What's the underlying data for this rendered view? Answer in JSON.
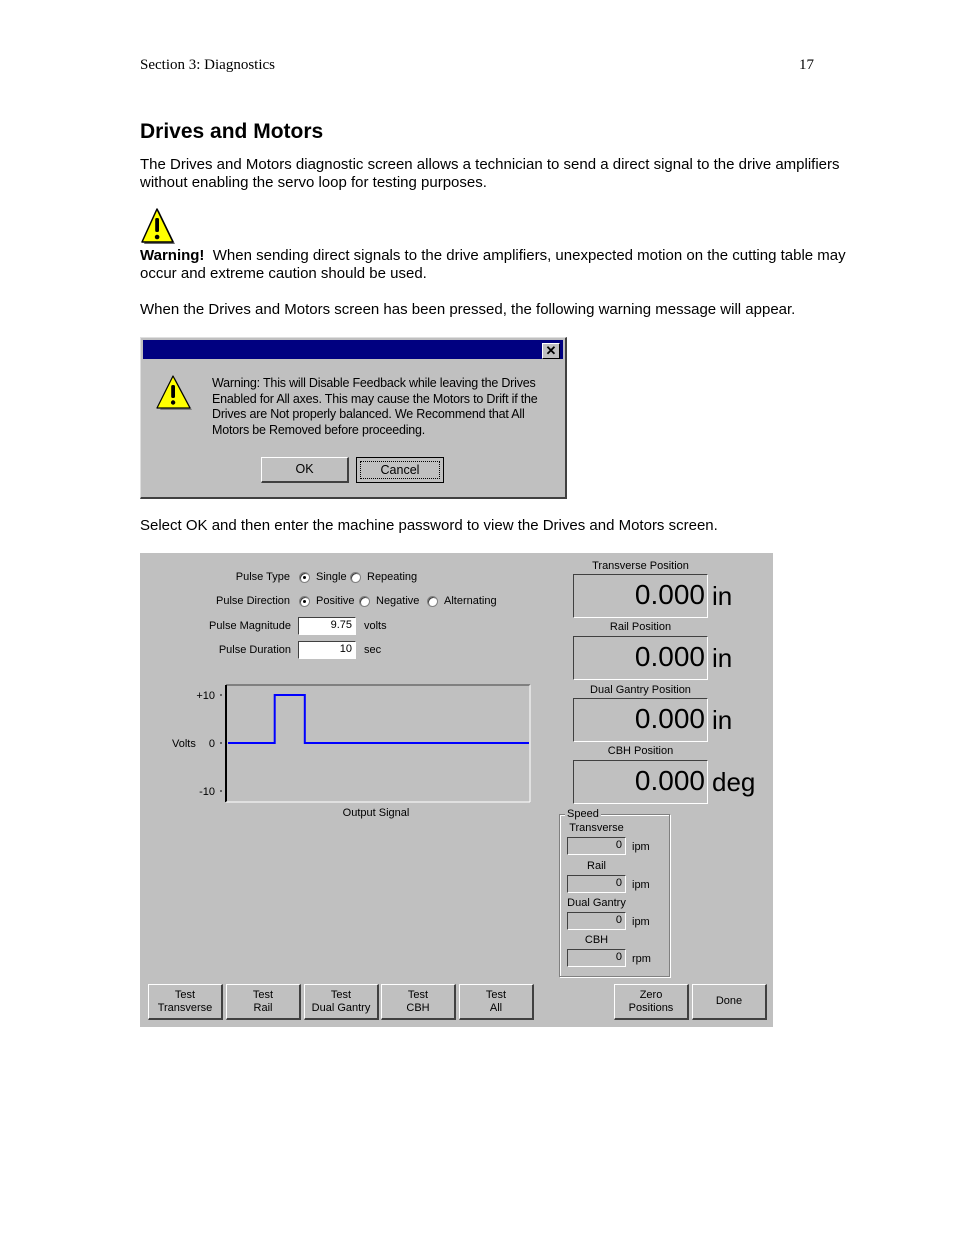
{
  "header": {
    "section": "Section 3: Diagnostics",
    "page_number": "17"
  },
  "title": "Drives and Motors",
  "paragraphs": {
    "intro": "The Drives and Motors diagnostic screen allows a technician to send a direct signal to the drive amplifiers without enabling the servo loop for testing purposes.",
    "warning_label": "Warning!",
    "warning_text": "  When sending direct signals to the drive amplifiers, unexpected motion on the cutting table may occur and extreme caution should be used.",
    "when_pressed": "When the Drives and Motors screen has been pressed, the following warning message will appear.",
    "select_ok": "Select OK and then enter the machine password to view the Drives and Motors screen."
  },
  "icons": {
    "warning": "warning-triangle-icon",
    "close": "close-icon"
  },
  "dialog": {
    "close_glyph": "✕",
    "message": "Warning: This will Disable Feedback while leaving the Drives Enabled for All axes.  This may cause the Motors to Drift if the Drives are Not properly balanced.  We Recommend that All Motors be Removed before proceeding.",
    "ok_label": "OK",
    "cancel_label": "Cancel"
  },
  "screen": {
    "pulse_type": {
      "label": "Pulse Type",
      "options": [
        "Single",
        "Repeating"
      ],
      "selected": "Single"
    },
    "pulse_direction": {
      "label": "Pulse Direction",
      "options": [
        "Positive",
        "Negative",
        "Alternating"
      ],
      "selected": "Positive"
    },
    "pulse_magnitude": {
      "label": "Pulse Magnitude",
      "value": "9.75",
      "unit": "volts"
    },
    "pulse_duration": {
      "label": "Pulse Duration",
      "value": "10",
      "unit": "sec"
    },
    "positions": [
      {
        "label": "Transverse Position",
        "value": "0.000",
        "unit": "in"
      },
      {
        "label": "Rail Position",
        "value": "0.000",
        "unit": "in"
      },
      {
        "label": "Dual Gantry Position",
        "value": "0.000",
        "unit": "in"
      },
      {
        "label": "CBH Position",
        "value": "0.000",
        "unit": "deg"
      }
    ],
    "speed": {
      "group_label": "Speed",
      "items": [
        {
          "label": "Transverse",
          "value": "0",
          "unit": "ipm"
        },
        {
          "label": "Rail",
          "value": "0",
          "unit": "ipm"
        },
        {
          "label": "Dual Gantry",
          "value": "0",
          "unit": "ipm"
        },
        {
          "label": "CBH",
          "value": "0",
          "unit": "rpm"
        }
      ]
    },
    "buttons": [
      {
        "line1": "Test",
        "line2": "Transverse"
      },
      {
        "line1": "Test",
        "line2": "Rail"
      },
      {
        "line1": "Test",
        "line2": "Dual Gantry"
      },
      {
        "line1": "Test",
        "line2": "CBH"
      },
      {
        "line1": "Test",
        "line2": "All"
      },
      {
        "line1": "Zero",
        "line2": "Positions"
      },
      {
        "line1": "Done",
        "line2": ""
      }
    ]
  },
  "chart_data": {
    "type": "line",
    "title": "Output Signal",
    "xlabel": "Output Signal",
    "ylabel": "Volts",
    "ylim": [
      -10,
      10
    ],
    "yticks": [
      "+10",
      "0",
      "-10"
    ],
    "ytick_values": [
      10,
      0,
      -10
    ],
    "xlim": [
      0,
      100
    ],
    "grid": false,
    "series": [
      {
        "name": "Output Signal",
        "color": "#0000ff",
        "x": [
          0,
          15.5,
          15.5,
          25.5,
          25.5,
          100
        ],
        "y": [
          0,
          0,
          10,
          10,
          0,
          0
        ]
      }
    ]
  }
}
